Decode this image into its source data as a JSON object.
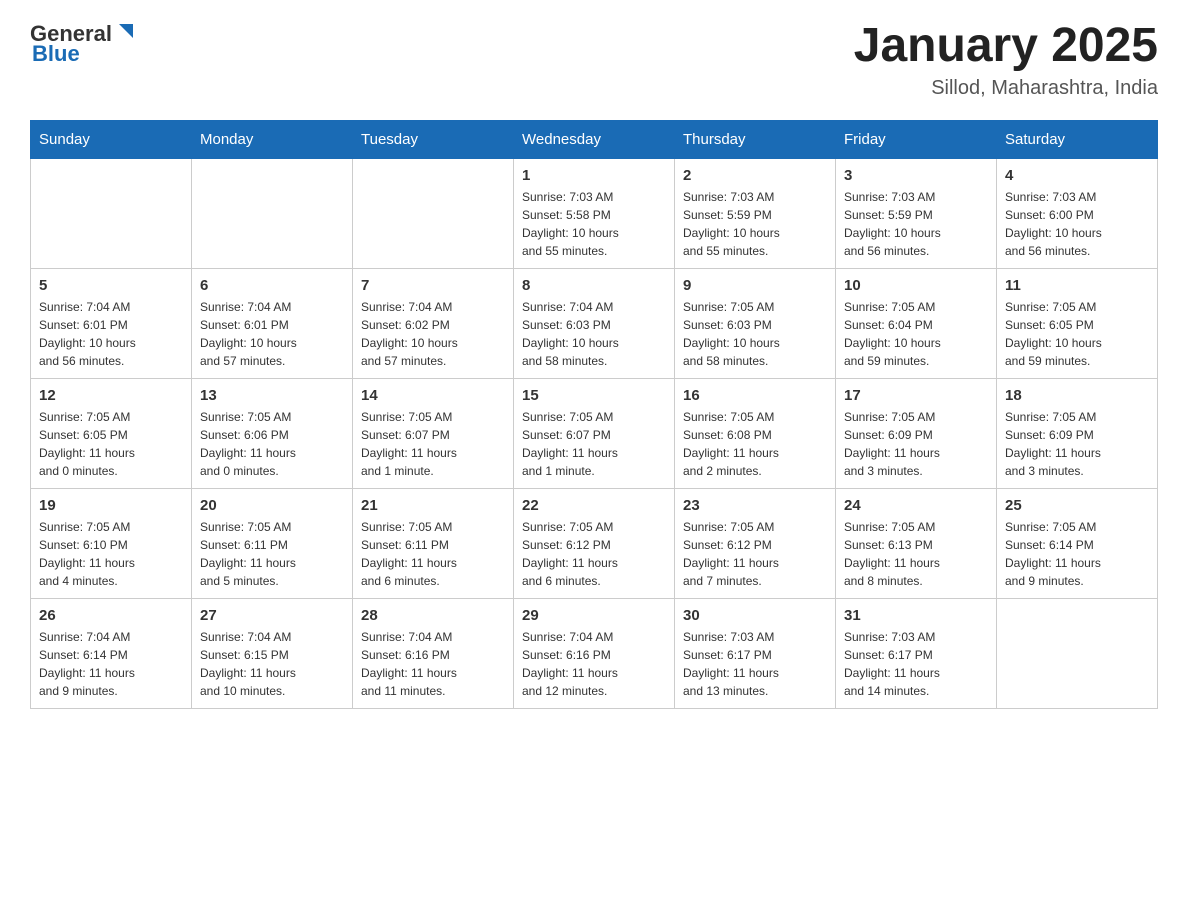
{
  "header": {
    "logo_general": "General",
    "logo_blue": "Blue",
    "month_title": "January 2025",
    "location": "Sillod, Maharashtra, India"
  },
  "weekdays": [
    "Sunday",
    "Monday",
    "Tuesday",
    "Wednesday",
    "Thursday",
    "Friday",
    "Saturday"
  ],
  "weeks": [
    [
      {
        "day": "",
        "info": ""
      },
      {
        "day": "",
        "info": ""
      },
      {
        "day": "",
        "info": ""
      },
      {
        "day": "1",
        "info": "Sunrise: 7:03 AM\nSunset: 5:58 PM\nDaylight: 10 hours\nand 55 minutes."
      },
      {
        "day": "2",
        "info": "Sunrise: 7:03 AM\nSunset: 5:59 PM\nDaylight: 10 hours\nand 55 minutes."
      },
      {
        "day": "3",
        "info": "Sunrise: 7:03 AM\nSunset: 5:59 PM\nDaylight: 10 hours\nand 56 minutes."
      },
      {
        "day": "4",
        "info": "Sunrise: 7:03 AM\nSunset: 6:00 PM\nDaylight: 10 hours\nand 56 minutes."
      }
    ],
    [
      {
        "day": "5",
        "info": "Sunrise: 7:04 AM\nSunset: 6:01 PM\nDaylight: 10 hours\nand 56 minutes."
      },
      {
        "day": "6",
        "info": "Sunrise: 7:04 AM\nSunset: 6:01 PM\nDaylight: 10 hours\nand 57 minutes."
      },
      {
        "day": "7",
        "info": "Sunrise: 7:04 AM\nSunset: 6:02 PM\nDaylight: 10 hours\nand 57 minutes."
      },
      {
        "day": "8",
        "info": "Sunrise: 7:04 AM\nSunset: 6:03 PM\nDaylight: 10 hours\nand 58 minutes."
      },
      {
        "day": "9",
        "info": "Sunrise: 7:05 AM\nSunset: 6:03 PM\nDaylight: 10 hours\nand 58 minutes."
      },
      {
        "day": "10",
        "info": "Sunrise: 7:05 AM\nSunset: 6:04 PM\nDaylight: 10 hours\nand 59 minutes."
      },
      {
        "day": "11",
        "info": "Sunrise: 7:05 AM\nSunset: 6:05 PM\nDaylight: 10 hours\nand 59 minutes."
      }
    ],
    [
      {
        "day": "12",
        "info": "Sunrise: 7:05 AM\nSunset: 6:05 PM\nDaylight: 11 hours\nand 0 minutes."
      },
      {
        "day": "13",
        "info": "Sunrise: 7:05 AM\nSunset: 6:06 PM\nDaylight: 11 hours\nand 0 minutes."
      },
      {
        "day": "14",
        "info": "Sunrise: 7:05 AM\nSunset: 6:07 PM\nDaylight: 11 hours\nand 1 minute."
      },
      {
        "day": "15",
        "info": "Sunrise: 7:05 AM\nSunset: 6:07 PM\nDaylight: 11 hours\nand 1 minute."
      },
      {
        "day": "16",
        "info": "Sunrise: 7:05 AM\nSunset: 6:08 PM\nDaylight: 11 hours\nand 2 minutes."
      },
      {
        "day": "17",
        "info": "Sunrise: 7:05 AM\nSunset: 6:09 PM\nDaylight: 11 hours\nand 3 minutes."
      },
      {
        "day": "18",
        "info": "Sunrise: 7:05 AM\nSunset: 6:09 PM\nDaylight: 11 hours\nand 3 minutes."
      }
    ],
    [
      {
        "day": "19",
        "info": "Sunrise: 7:05 AM\nSunset: 6:10 PM\nDaylight: 11 hours\nand 4 minutes."
      },
      {
        "day": "20",
        "info": "Sunrise: 7:05 AM\nSunset: 6:11 PM\nDaylight: 11 hours\nand 5 minutes."
      },
      {
        "day": "21",
        "info": "Sunrise: 7:05 AM\nSunset: 6:11 PM\nDaylight: 11 hours\nand 6 minutes."
      },
      {
        "day": "22",
        "info": "Sunrise: 7:05 AM\nSunset: 6:12 PM\nDaylight: 11 hours\nand 6 minutes."
      },
      {
        "day": "23",
        "info": "Sunrise: 7:05 AM\nSunset: 6:12 PM\nDaylight: 11 hours\nand 7 minutes."
      },
      {
        "day": "24",
        "info": "Sunrise: 7:05 AM\nSunset: 6:13 PM\nDaylight: 11 hours\nand 8 minutes."
      },
      {
        "day": "25",
        "info": "Sunrise: 7:05 AM\nSunset: 6:14 PM\nDaylight: 11 hours\nand 9 minutes."
      }
    ],
    [
      {
        "day": "26",
        "info": "Sunrise: 7:04 AM\nSunset: 6:14 PM\nDaylight: 11 hours\nand 9 minutes."
      },
      {
        "day": "27",
        "info": "Sunrise: 7:04 AM\nSunset: 6:15 PM\nDaylight: 11 hours\nand 10 minutes."
      },
      {
        "day": "28",
        "info": "Sunrise: 7:04 AM\nSunset: 6:16 PM\nDaylight: 11 hours\nand 11 minutes."
      },
      {
        "day": "29",
        "info": "Sunrise: 7:04 AM\nSunset: 6:16 PM\nDaylight: 11 hours\nand 12 minutes."
      },
      {
        "day": "30",
        "info": "Sunrise: 7:03 AM\nSunset: 6:17 PM\nDaylight: 11 hours\nand 13 minutes."
      },
      {
        "day": "31",
        "info": "Sunrise: 7:03 AM\nSunset: 6:17 PM\nDaylight: 11 hours\nand 14 minutes."
      },
      {
        "day": "",
        "info": ""
      }
    ]
  ]
}
